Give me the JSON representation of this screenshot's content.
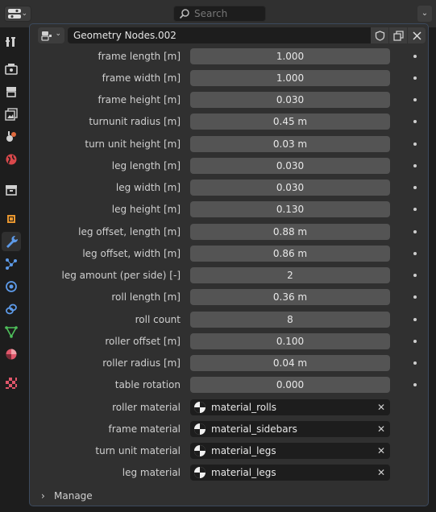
{
  "header": {
    "search_placeholder": "Search"
  },
  "modifier": {
    "name": "Geometry Nodes.002"
  },
  "params": [
    {
      "label": "frame length [m]",
      "value": "1.000"
    },
    {
      "label": "frame width [m]",
      "value": "1.000"
    },
    {
      "label": "frame height [m]",
      "value": "0.030"
    },
    {
      "label": "turnunit radius [m]",
      "value": "0.45 m"
    },
    {
      "label": "turn unit height [m]",
      "value": "0.03 m"
    },
    {
      "label": "leg length [m]",
      "value": "0.030"
    },
    {
      "label": "leg width [m]",
      "value": "0.030"
    },
    {
      "label": "leg height [m]",
      "value": "0.130"
    },
    {
      "label": "leg offset, length [m]",
      "value": "0.88 m"
    },
    {
      "label": "leg offset, width [m]",
      "value": "0.86 m"
    },
    {
      "label": "leg amount (per side) [-]",
      "value": "2"
    },
    {
      "label": "roll length [m]",
      "value": "0.36 m"
    },
    {
      "label": "roll count",
      "value": "8"
    },
    {
      "label": "roller offset [m]",
      "value": "0.100"
    },
    {
      "label": "roller radius [m]",
      "value": "0.04 m"
    },
    {
      "label": "table rotation",
      "value": "0.000"
    }
  ],
  "materials": [
    {
      "label": "roller material",
      "value": "material_rolls"
    },
    {
      "label": "frame material",
      "value": "material_sidebars"
    },
    {
      "label": "turn unit material",
      "value": "material_legs"
    },
    {
      "label": "leg material",
      "value": "material_legs"
    }
  ],
  "manage": {
    "label": "Manage"
  },
  "colors": {
    "background": "#1d1d1d",
    "panel": "#303030",
    "field": "#545454",
    "panel_border": "#3c4a5e"
  },
  "icons": {
    "tabs": [
      "tool-icon",
      "render-icon",
      "output-icon",
      "view-layer-icon",
      "scene-icon",
      "world-icon",
      "collection-icon",
      "object-icon",
      "modifier-icon",
      "particles-icon",
      "physics-icon",
      "constraints-icon",
      "data-icon",
      "material-icon",
      "texture-icon"
    ]
  }
}
